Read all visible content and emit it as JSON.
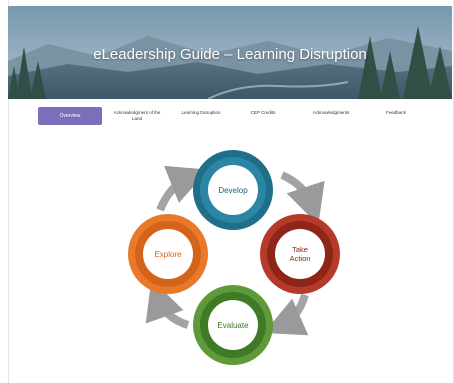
{
  "banner": {
    "title": "eLeadership Guide – Learning Disruption"
  },
  "nav": {
    "tabs": [
      {
        "label": "Overview",
        "active": true
      },
      {
        "label": "Acknowledgment of the Land",
        "active": false
      },
      {
        "label": "Learning Disruption",
        "active": false
      },
      {
        "label": "CEP Credits",
        "active": false
      },
      {
        "label": "Acknowledgments",
        "active": false
      },
      {
        "label": "Feedback",
        "active": false
      }
    ]
  },
  "cycle": {
    "steps": [
      {
        "label": "Develop",
        "color": "#1f6f8b"
      },
      {
        "label": "Take Action",
        "color": "#b53a2b"
      },
      {
        "label": "Evaluate",
        "color": "#5f9a3a"
      },
      {
        "label": "Explore",
        "color": "#e8792a"
      }
    ],
    "arrow_color": "#9a9a9a"
  }
}
